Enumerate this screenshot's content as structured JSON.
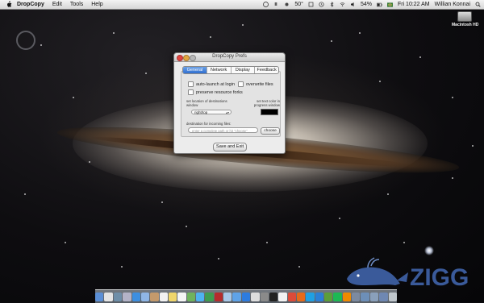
{
  "menubar": {
    "app_name": "DropCopy",
    "menus": [
      "Edit",
      "Tools",
      "Help"
    ],
    "status": {
      "temperature": "50°",
      "battery": "54%",
      "clock": "Fri 10:22 AM",
      "user": "Willian Konnai"
    }
  },
  "desktop": {
    "drive_label": "Macintosh HD"
  },
  "prefs_window": {
    "title": "DropCopy Prefs",
    "tabs": [
      {
        "label": "General",
        "active": true
      },
      {
        "label": "Network",
        "active": false
      },
      {
        "label": "Display",
        "active": false
      },
      {
        "label": "Feedback",
        "active": false
      }
    ],
    "options": {
      "auto_launch": "auto-launch at login",
      "overwrite": "overwrite files",
      "preserve_forks": "preserve resource forks"
    },
    "location_label": "set location of destinations window",
    "location_value": "right/top",
    "text_color_label": "set text color in progress window",
    "text_color": "#000000",
    "destination_label": "destination for incoming files:",
    "destination_placeholder": "enter a complete path or hit \"choose\"",
    "choose_label": "choose",
    "save_label": "Save and Exit"
  },
  "watermark": {
    "text": "ZIGG"
  },
  "colors": {
    "accent": "#2f6fd0",
    "close": "#e0443e",
    "minimize": "#e1a73e",
    "watermark_blue": "#3a5a9a"
  },
  "dock": {
    "icons": [
      "finder-icon",
      "dashboard-icon",
      "mission-control-icon",
      "launchpad-icon",
      "safari-icon",
      "mail-icon",
      "contacts-icon",
      "calendar-icon",
      "notes-icon",
      "reminders-icon",
      "maps-icon",
      "messages-icon",
      "facetime-icon",
      "photo-booth-icon",
      "iphoto-icon",
      "itunes-icon",
      "app-store-icon",
      "preview-icon",
      "system-preferences-icon",
      "terminal-icon",
      "textedit-icon",
      "chrome-icon",
      "firefox-icon",
      "skype-icon",
      "dropbox-icon",
      "evernote-icon",
      "spotify-icon",
      "vlc-icon",
      "utilities-icon",
      "downloads-stack-icon",
      "documents-stack-icon",
      "applications-stack-icon",
      "trash-icon"
    ]
  }
}
